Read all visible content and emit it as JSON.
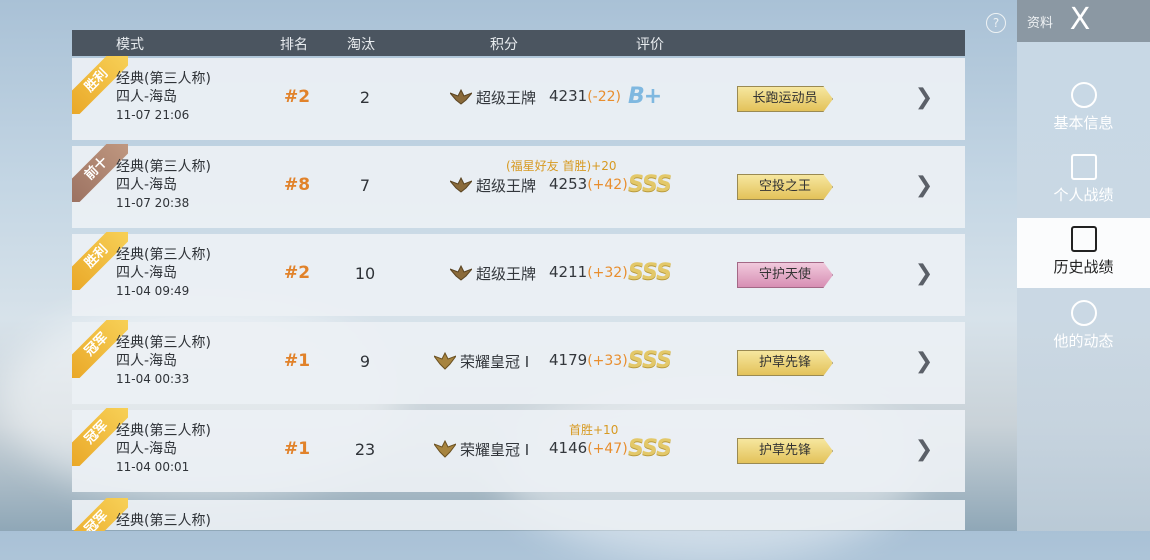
{
  "header": {
    "mode": "模式",
    "rank": "排名",
    "kills": "淘汰",
    "score": "积分",
    "rating": "评价"
  },
  "rows": [
    {
      "ribbon": "胜利",
      "mode": "经典(第三人称)",
      "map": "四人-海岛",
      "time": "11-07 21:06",
      "rank": "#2",
      "kills": "2",
      "tier": "超级王牌",
      "score": "4231",
      "delta": "(-22)",
      "bonus": "",
      "grade": "B+",
      "badge": "长跑运动员"
    },
    {
      "ribbon": "前十",
      "mode": "经典(第三人称)",
      "map": "四人-海岛",
      "time": "11-07 20:38",
      "rank": "#8",
      "kills": "7",
      "tier": "超级王牌",
      "score": "4253",
      "delta": "(+42)",
      "bonus": "(福星好友 首胜)+20",
      "grade": "SSS",
      "badge": "空投之王"
    },
    {
      "ribbon": "胜利",
      "mode": "经典(第三人称)",
      "map": "四人-海岛",
      "time": "11-04 09:49",
      "rank": "#2",
      "kills": "10",
      "tier": "超级王牌",
      "score": "4211",
      "delta": "(+32)",
      "bonus": "",
      "grade": "SSS",
      "badge": "守护天使"
    },
    {
      "ribbon": "冠军",
      "mode": "经典(第三人称)",
      "map": "四人-海岛",
      "time": "11-04 00:33",
      "rank": "#1",
      "kills": "9",
      "tier": "荣耀皇冠 I",
      "score": "4179",
      "delta": "(+33)",
      "bonus": "",
      "grade": "SSS",
      "badge": "护草先锋"
    },
    {
      "ribbon": "冠军",
      "mode": "经典(第三人称)",
      "map": "四人-海岛",
      "time": "11-04 00:01",
      "rank": "#1",
      "kills": "23",
      "tier": "荣耀皇冠 I",
      "score": "4146",
      "delta": "(+47)",
      "bonus": "首胜+10",
      "grade": "SSS",
      "badge": "护草先锋"
    },
    {
      "ribbon": "冠军",
      "mode": "经典(第三人称)"
    }
  ],
  "sidebar": {
    "top_label": "资料",
    "close": "X",
    "help": "?",
    "items": [
      {
        "label": "基本信息",
        "icon": "user-icon"
      },
      {
        "label": "个人战绩",
        "icon": "stats-icon"
      },
      {
        "label": "历史战绩",
        "icon": "history-icon"
      },
      {
        "label": "他的动态",
        "icon": "activity-icon"
      }
    ]
  },
  "colors": {
    "rank": "#e1822a",
    "delta": "#e88e2e",
    "bonus": "#d79a22",
    "header_bg": "#4b5560"
  }
}
